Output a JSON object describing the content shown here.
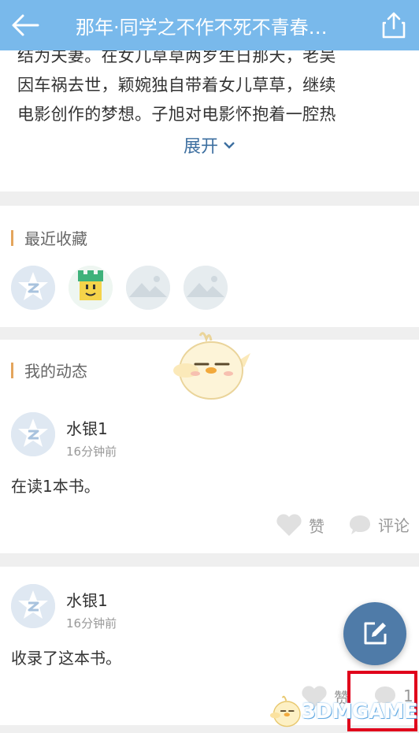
{
  "header": {
    "title": "那年·同学之不作不死不青春…",
    "back_icon": "back-arrow-icon",
    "share_icon": "share-icon",
    "background": "#79b9eb"
  },
  "description": {
    "lines": [
      "结为夫妻。在女儿草草两岁生日那天，老吴",
      "因车祸去世，颖婉独自带着女儿草草，继续",
      "电影创作的梦想。子旭对电影怀抱着一腔热"
    ],
    "expand_label": "展开"
  },
  "favorites": {
    "title": "最近收藏",
    "items": [
      {
        "icon": "default-avatar-icon"
      },
      {
        "icon": "castle-face-icon"
      },
      {
        "icon": "mountain-placeholder-icon"
      },
      {
        "icon": "mountain-placeholder-icon"
      }
    ]
  },
  "activity": {
    "title": "我的动态",
    "posts": [
      {
        "user": "水银1",
        "time": "16分钟前",
        "text": "在读1本书。",
        "like_label": "赞",
        "comment_label": "评论"
      },
      {
        "user": "水银1",
        "time": "16分钟前",
        "text": "收录了这本书。",
        "like_label": "赞",
        "comment_label": "1"
      }
    ]
  },
  "fab": {
    "icon": "edit-icon",
    "color": "#4f7ba8"
  },
  "watermark": {
    "text": "3DMGAME"
  },
  "accent_color": "#e4a55c",
  "highlight_color": "#e0001b"
}
